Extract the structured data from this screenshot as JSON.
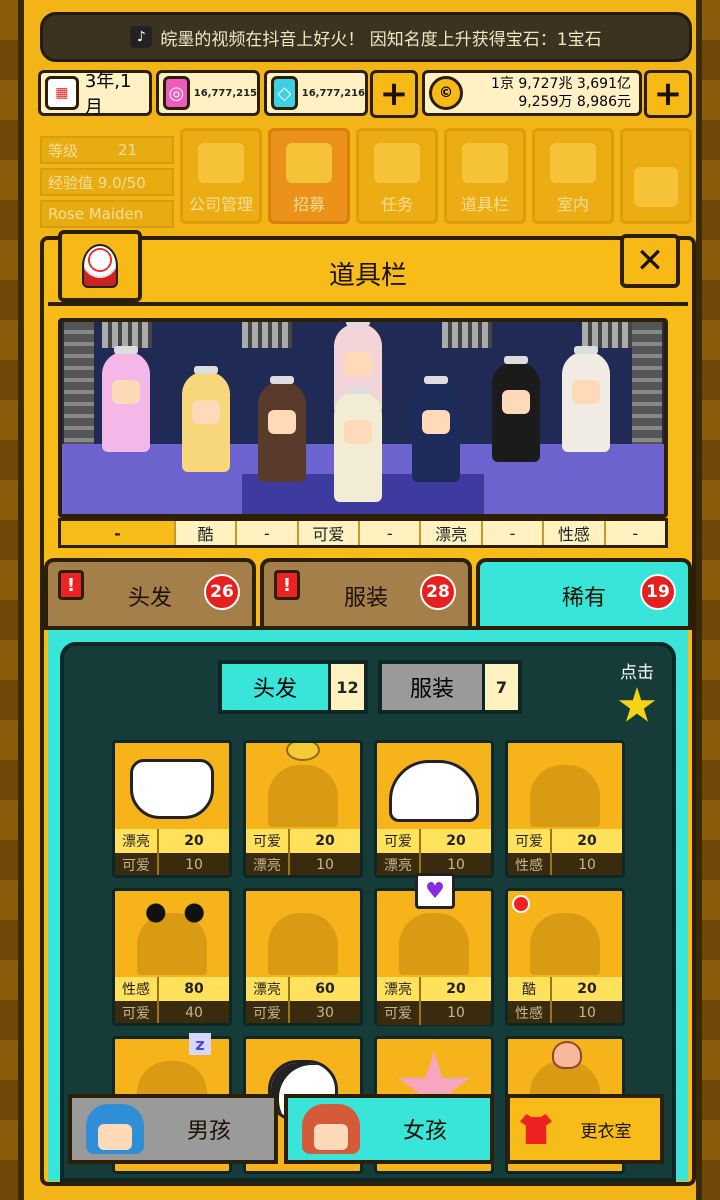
{
  "ticker": {
    "text": "皖墨的视频在抖音上好火！ 因知名度上升获得宝石：1宝石"
  },
  "topbar": {
    "date": "3年,1月",
    "gem_pink": "16,777,215",
    "gem_blue": "16,777,216",
    "money_line1": "1京 9,727兆 3,691亿",
    "money_line2": "9,259万 8,986元"
  },
  "menu": {
    "level_label": "等级",
    "level_value": "21",
    "exp_label": "经验值 9.0/50",
    "name": "Rose Maiden",
    "items": [
      "公司管理",
      "招募",
      "任务",
      "道具栏",
      "室内"
    ]
  },
  "panel": {
    "title": "道具栏",
    "traits": [
      "-",
      "酷",
      "-",
      "可爱",
      "-",
      "漂亮",
      "-",
      "性感",
      "-"
    ],
    "tabs": [
      {
        "label": "头发",
        "count": "26"
      },
      {
        "label": "服装",
        "count": "28"
      },
      {
        "label": "稀有",
        "count": "19"
      }
    ],
    "subtabs": [
      {
        "label": "头发",
        "count": "12"
      },
      {
        "label": "服装",
        "count": "7"
      }
    ],
    "tap_hint": "点击",
    "items": [
      {
        "s1": "漂亮",
        "v1": "20",
        "s2": "可爱",
        "v2": "10",
        "icon": "white-bonnet-icon"
      },
      {
        "s1": "可爱",
        "v1": "20",
        "s2": "漂亮",
        "v2": "10",
        "icon": "hair-silhouette-icon"
      },
      {
        "s1": "可爱",
        "v1": "20",
        "s2": "漂亮",
        "v2": "10",
        "icon": "bunny-hood-icon"
      },
      {
        "s1": "可爱",
        "v1": "20",
        "s2": "性感",
        "v2": "10",
        "icon": "hair-silhouette-icon"
      },
      {
        "s1": "性感",
        "v1": "80",
        "s2": "可爱",
        "v2": "40",
        "icon": "bow-icon"
      },
      {
        "s1": "漂亮",
        "v1": "60",
        "s2": "可爱",
        "v2": "30",
        "icon": "hair-silhouette-icon"
      },
      {
        "s1": "漂亮",
        "v1": "20",
        "s2": "可爱",
        "v2": "10",
        "icon": "hair-silhouette-icon"
      },
      {
        "s1": "酷",
        "v1": "20",
        "s2": "性感",
        "v2": "10",
        "icon": "hair-silhouette-icon"
      },
      {
        "icon": "sleep-hair-icon"
      },
      {
        "icon": "panda-icon"
      },
      {
        "icon": "starfish-icon"
      },
      {
        "icon": "peach-icon"
      }
    ]
  },
  "bottom": {
    "boy": "男孩",
    "girl": "女孩",
    "wardrobe": "更衣室"
  },
  "colors": {
    "accent": "#f7bc18",
    "teal": "#38e5d8",
    "dark": "#163c3a",
    "alert": "#e5201f"
  }
}
